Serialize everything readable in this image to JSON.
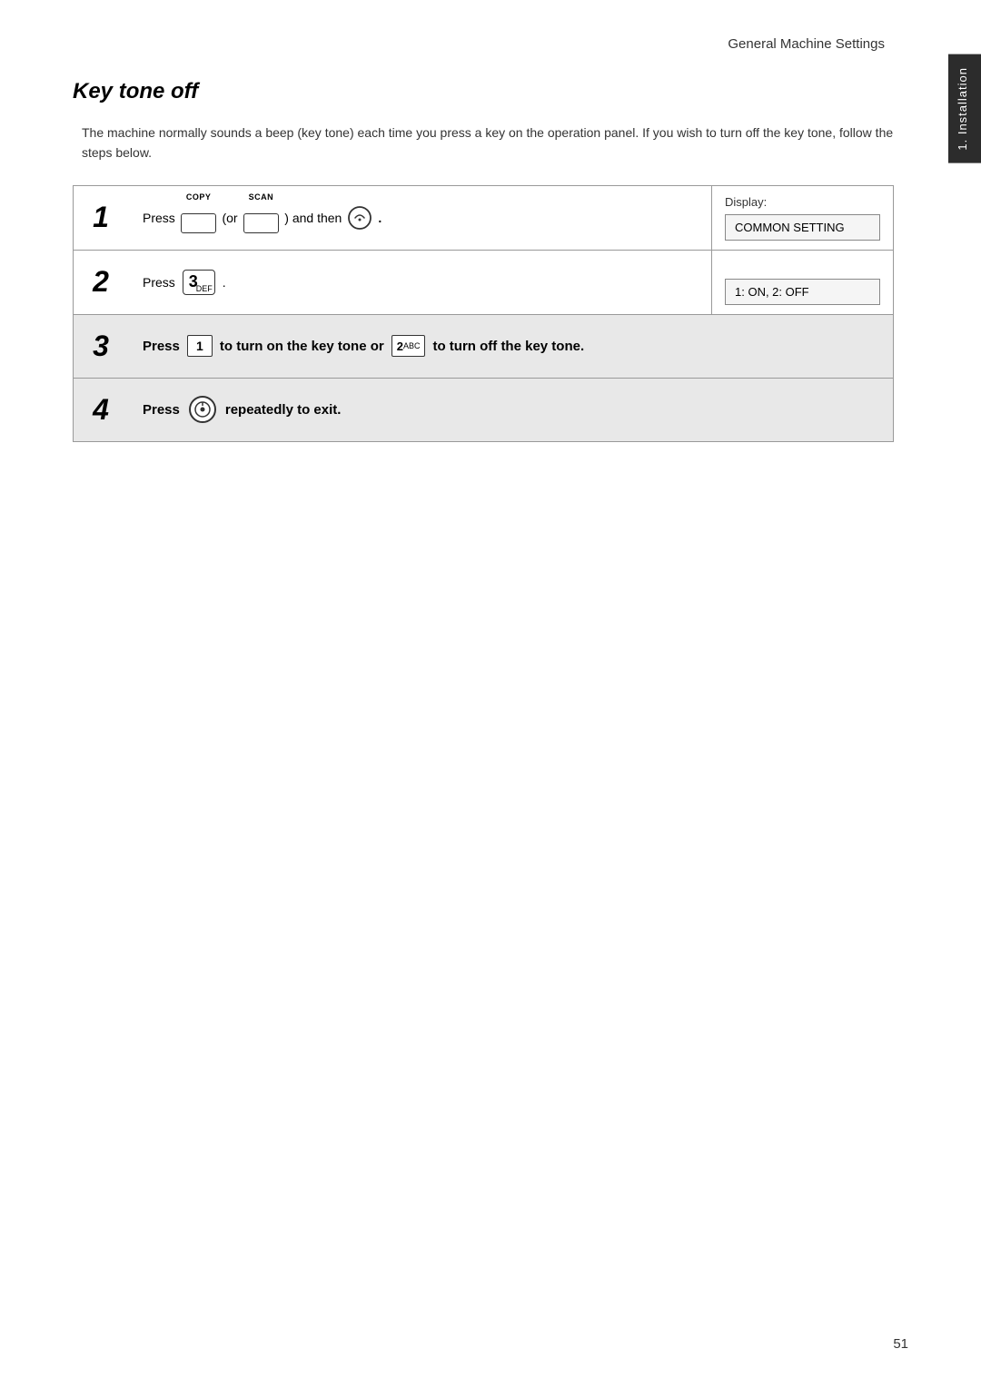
{
  "header": {
    "title": "General Machine Settings"
  },
  "side_tab": {
    "label": "1. Installation"
  },
  "section": {
    "title": "Key tone off",
    "intro": "The machine normally sounds a beep (key tone) each time you press a key on the operation panel. If you wish to turn off the key tone, follow the steps below."
  },
  "steps": [
    {
      "number": "1",
      "content_parts": [
        {
          "type": "text",
          "value": "Press"
        },
        {
          "type": "key",
          "label": "COPY",
          "text": ""
        },
        {
          "type": "text",
          "value": "(or"
        },
        {
          "type": "key",
          "label": "SCAN",
          "text": ""
        },
        {
          "type": "text",
          "value": ") and then"
        },
        {
          "type": "menu-icon"
        }
      ],
      "display_label": "Display:",
      "display_value": "COMMON SETTING",
      "has_display": true,
      "gray": false
    },
    {
      "number": "2",
      "content_parts": [
        {
          "type": "text",
          "value": "Press"
        },
        {
          "type": "numkey",
          "value": "3",
          "sub": "DEF"
        }
      ],
      "display_label": "",
      "display_value": "1: ON, 2: OFF",
      "has_display": true,
      "gray": false
    },
    {
      "number": "3",
      "content_parts": [
        {
          "type": "text_bold",
          "value": "Press"
        },
        {
          "type": "numkey_sq",
          "value": "1"
        },
        {
          "type": "text_bold",
          "value": "to turn on the key tone or"
        },
        {
          "type": "numkey_sq",
          "value": "2ABC"
        },
        {
          "type": "text_bold",
          "value": "to turn off the key tone."
        }
      ],
      "has_display": false,
      "gray": true
    },
    {
      "number": "4",
      "content_parts": [
        {
          "type": "text_bold",
          "value": "Press"
        },
        {
          "type": "stop_icon"
        },
        {
          "type": "text_bold",
          "value": "repeatedly to exit."
        }
      ],
      "has_display": false,
      "gray": true
    }
  ],
  "page_number": "51",
  "buttons": {
    "press_label": "Press",
    "or_label": "(or",
    "and_then_label": ") and then"
  }
}
